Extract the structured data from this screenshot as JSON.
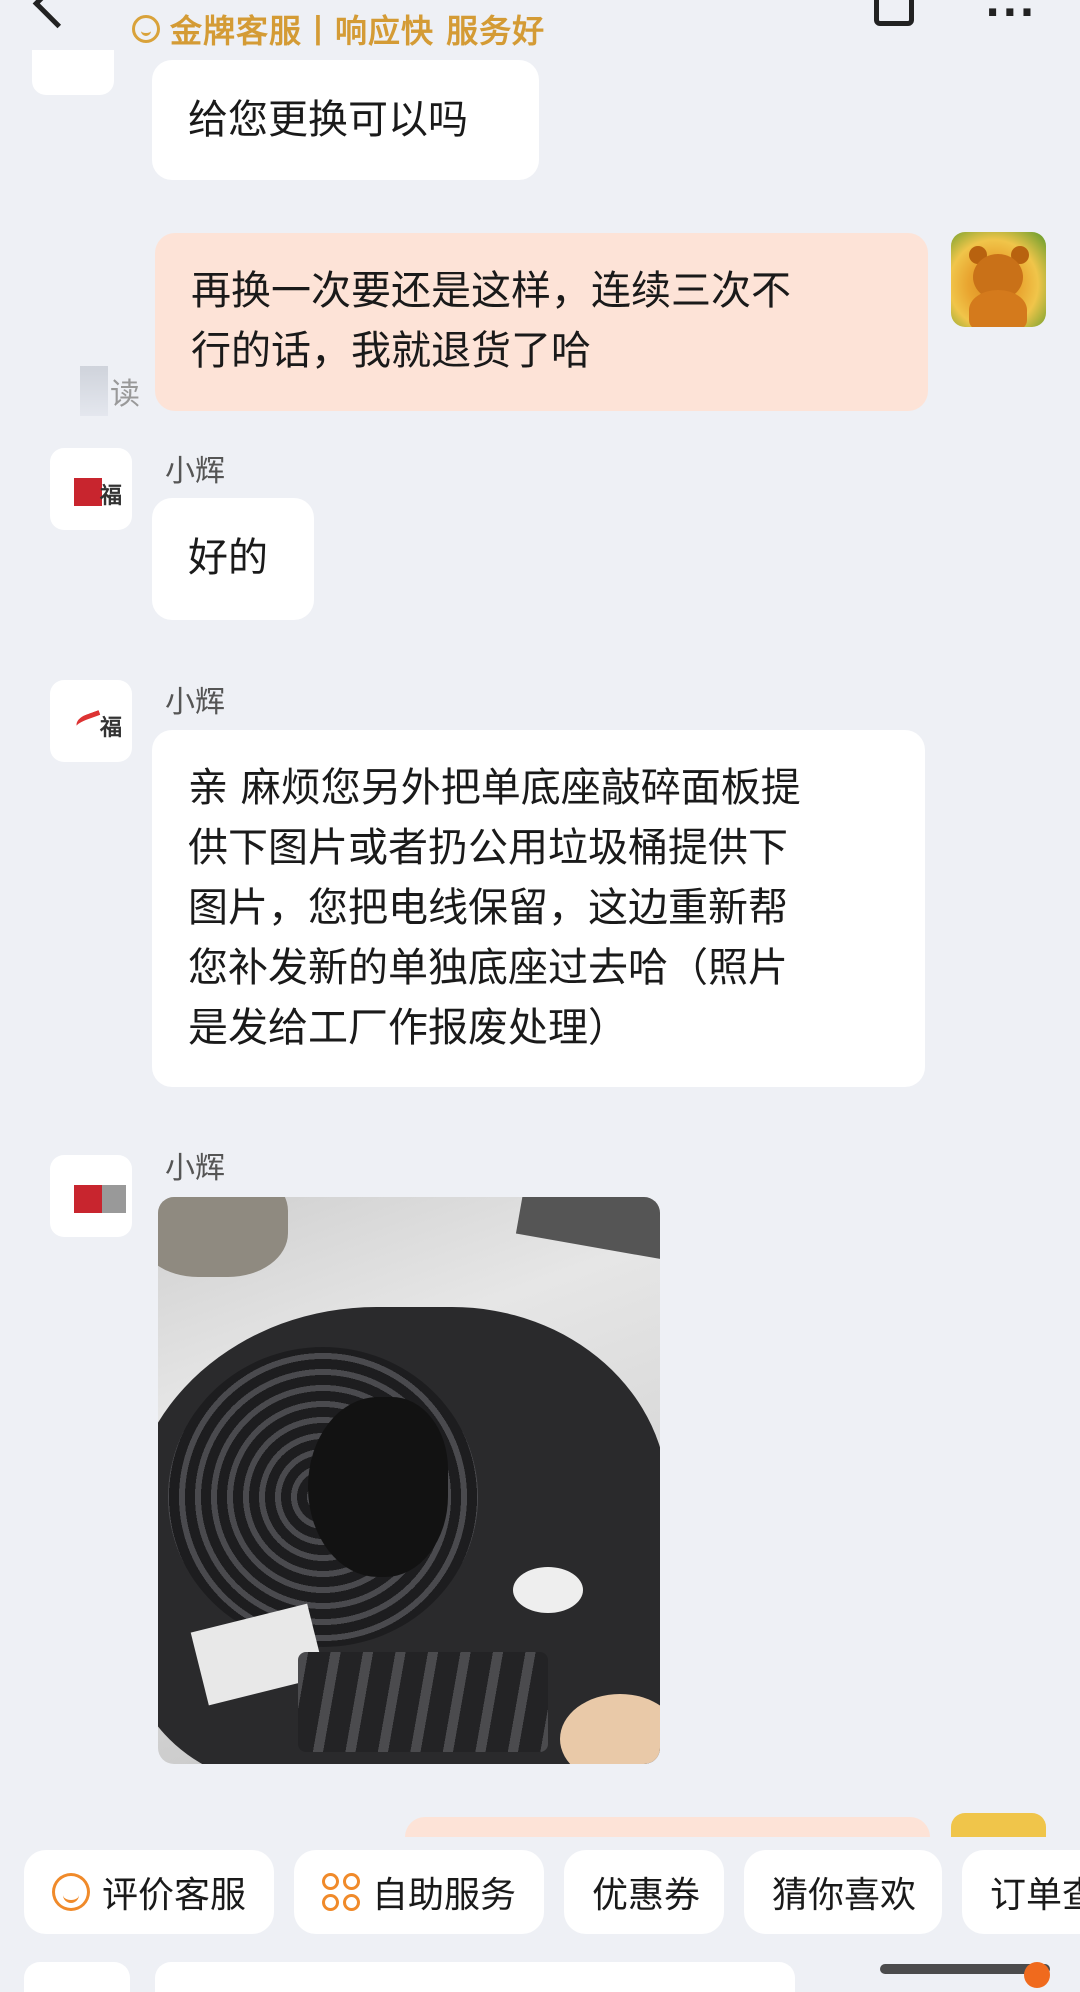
{
  "header": {
    "badge": "金牌客服丨响应快 服务好"
  },
  "messages": {
    "m1": {
      "text": "给您更换可以吗"
    },
    "m2": {
      "text": "再换一次要还是这样，连续三次不\n行的话，我就退货了哈",
      "read_status": "读"
    },
    "m3": {
      "sender": "小辉",
      "text": "好的"
    },
    "m4": {
      "sender": "小辉",
      "text": "亲 麻烦您另外把单底座敲碎面板提\n供下图片或者扔公用垃圾桶提供下\n图片，您把电线保留，这边重新帮\n您补发新的单独底座过去哈（照片\n是发给工厂作报废处理）"
    },
    "m5": {
      "sender": "小辉"
    }
  },
  "avatar_text": "福",
  "quick_actions": [
    {
      "label": "评价客服",
      "icon": "smile-icon"
    },
    {
      "label": "自助服务",
      "icon": "grid-icon"
    },
    {
      "label": "优惠券"
    },
    {
      "label": "猜你喜欢"
    },
    {
      "label": "订单查"
    }
  ],
  "colors": {
    "badge": "#d49b35",
    "my_bubble": "#fde3d7",
    "background": "#eef0f5",
    "accent": "#f08a2a"
  }
}
